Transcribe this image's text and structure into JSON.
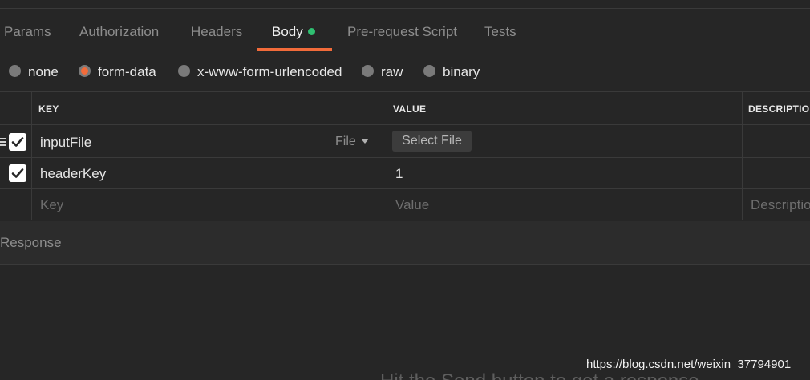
{
  "tabs": [
    {
      "label": "Params",
      "active": false
    },
    {
      "label": "Authorization",
      "active": false
    },
    {
      "label": "Headers",
      "active": false
    },
    {
      "label": "Body",
      "active": true,
      "indicator": "green-dot"
    },
    {
      "label": "Pre-request Script",
      "active": false
    },
    {
      "label": "Tests",
      "active": false
    }
  ],
  "body_types": [
    {
      "label": "none",
      "selected": false
    },
    {
      "label": "form-data",
      "selected": true
    },
    {
      "label": "x-www-form-urlencoded",
      "selected": false
    },
    {
      "label": "raw",
      "selected": false
    },
    {
      "label": "binary",
      "selected": false
    }
  ],
  "table": {
    "headers": {
      "key": "KEY",
      "value": "VALUE",
      "description": "DESCRIPTIO"
    },
    "rows": [
      {
        "checked": true,
        "key": "inputFile",
        "type_label": "File",
        "value_button": "Select File"
      },
      {
        "checked": true,
        "key": "headerKey",
        "value": "1"
      }
    ],
    "new_row": {
      "key_placeholder": "Key",
      "value_placeholder": "Value",
      "description_placeholder": "Descriptio"
    }
  },
  "response": {
    "label": "Response"
  },
  "hint": "Hit the Send button to get a response",
  "watermark": "https://blog.csdn.net/weixin_37794901",
  "colors": {
    "accent": "#f26b3a",
    "indicator": "#2fbf71",
    "background": "#262626"
  },
  "icons": [
    "checkbox-check-icon",
    "drag-handle-icon",
    "caret-down-icon"
  ]
}
